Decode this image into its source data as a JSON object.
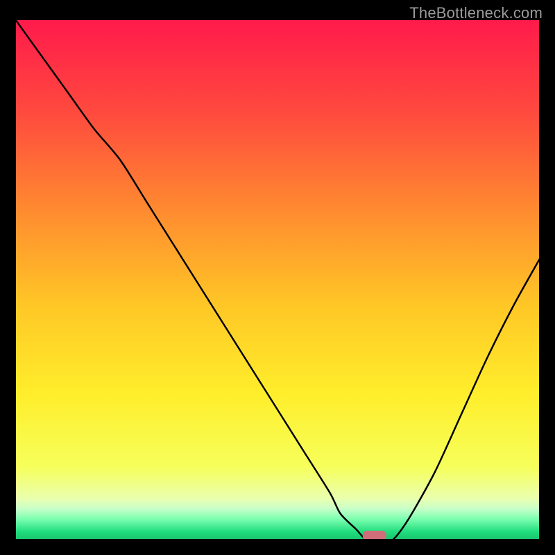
{
  "watermark": "TheBottleneck.com",
  "chart_data": {
    "type": "line",
    "title": "",
    "xlabel": "",
    "ylabel": "",
    "xlim": [
      0,
      100
    ],
    "ylim": [
      0,
      100
    ],
    "x": [
      0,
      5,
      10,
      15,
      20,
      25,
      30,
      35,
      40,
      45,
      50,
      55,
      60,
      62,
      65,
      67,
      70,
      72,
      75,
      80,
      85,
      90,
      95,
      100
    ],
    "y": [
      100,
      93,
      86,
      79,
      73,
      65,
      57,
      49,
      41,
      33,
      25,
      17,
      9,
      5,
      2,
      0,
      0,
      0,
      4,
      13,
      24,
      35,
      45,
      54
    ],
    "marker": {
      "x": 68.5,
      "y": 0.8
    },
    "gradient_stops": [
      {
        "offset": 0.0,
        "color": "#ff1a4b"
      },
      {
        "offset": 0.18,
        "color": "#ff4a3e"
      },
      {
        "offset": 0.38,
        "color": "#ff8f2f"
      },
      {
        "offset": 0.55,
        "color": "#ffc726"
      },
      {
        "offset": 0.72,
        "color": "#ffee2b"
      },
      {
        "offset": 0.86,
        "color": "#f6ff5b"
      },
      {
        "offset": 0.92,
        "color": "#eaffad"
      },
      {
        "offset": 0.94,
        "color": "#c9ffc9"
      },
      {
        "offset": 0.96,
        "color": "#7dffb0"
      },
      {
        "offset": 0.985,
        "color": "#1fdd7d"
      },
      {
        "offset": 1.0,
        "color": "#19c46e"
      }
    ]
  }
}
